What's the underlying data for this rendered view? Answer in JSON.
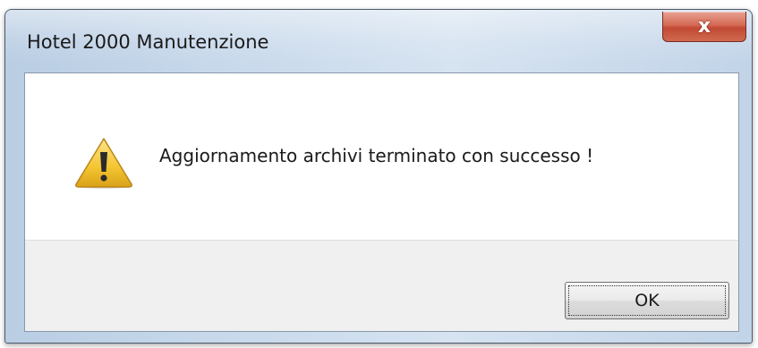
{
  "window": {
    "title": "Hotel 2000 Manutenzione",
    "close_glyph": "x",
    "close_icon": "close-icon"
  },
  "message": {
    "icon": "warning-icon",
    "text": "Aggiornamento archivi terminato con successo !"
  },
  "buttons": {
    "ok_label": "OK"
  },
  "colors": {
    "close_button": "#c9533c",
    "warning_fill": "#f4c430",
    "client_background": "#ffffff",
    "button_panel": "#f0f0f0"
  }
}
